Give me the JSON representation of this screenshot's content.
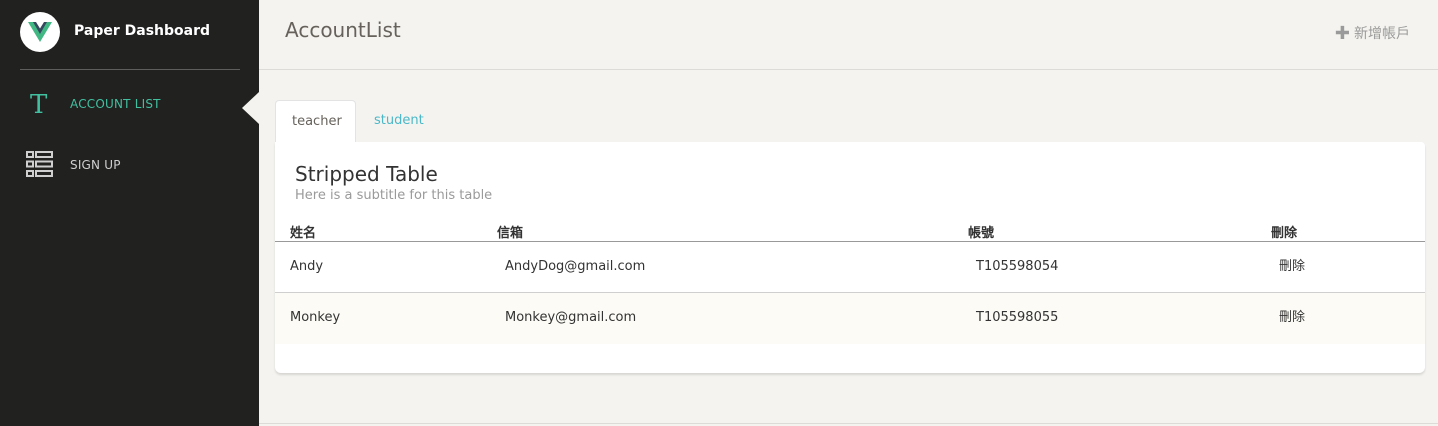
{
  "sidebar": {
    "brand_name": "Paper Dashboard",
    "items": [
      {
        "label": "ACCOUNT LIST",
        "icon": "text-t-icon",
        "active": true
      },
      {
        "label": "SIGN UP",
        "icon": "list-view-icon",
        "active": false
      }
    ],
    "accent_color": "#41c0a0",
    "background_color": "#212120"
  },
  "header": {
    "title": "AccountList",
    "add_button_label": "新增帳戶",
    "add_button_icon": "plus-icon"
  },
  "tabs": [
    {
      "label": "teacher",
      "active": true
    },
    {
      "label": "student",
      "active": false
    }
  ],
  "card": {
    "title": "Stripped Table",
    "subtitle": "Here is a subtitle for this table",
    "columns": [
      "姓名",
      "信箱",
      "帳號",
      "刪除"
    ],
    "rows": [
      {
        "name": "Andy",
        "email": "AndyDog@gmail.com",
        "account": "T105598054",
        "delete_label": "刪除"
      },
      {
        "name": "Monkey",
        "email": "Monkey@gmail.com",
        "account": "T105598055",
        "delete_label": "刪除"
      }
    ]
  }
}
